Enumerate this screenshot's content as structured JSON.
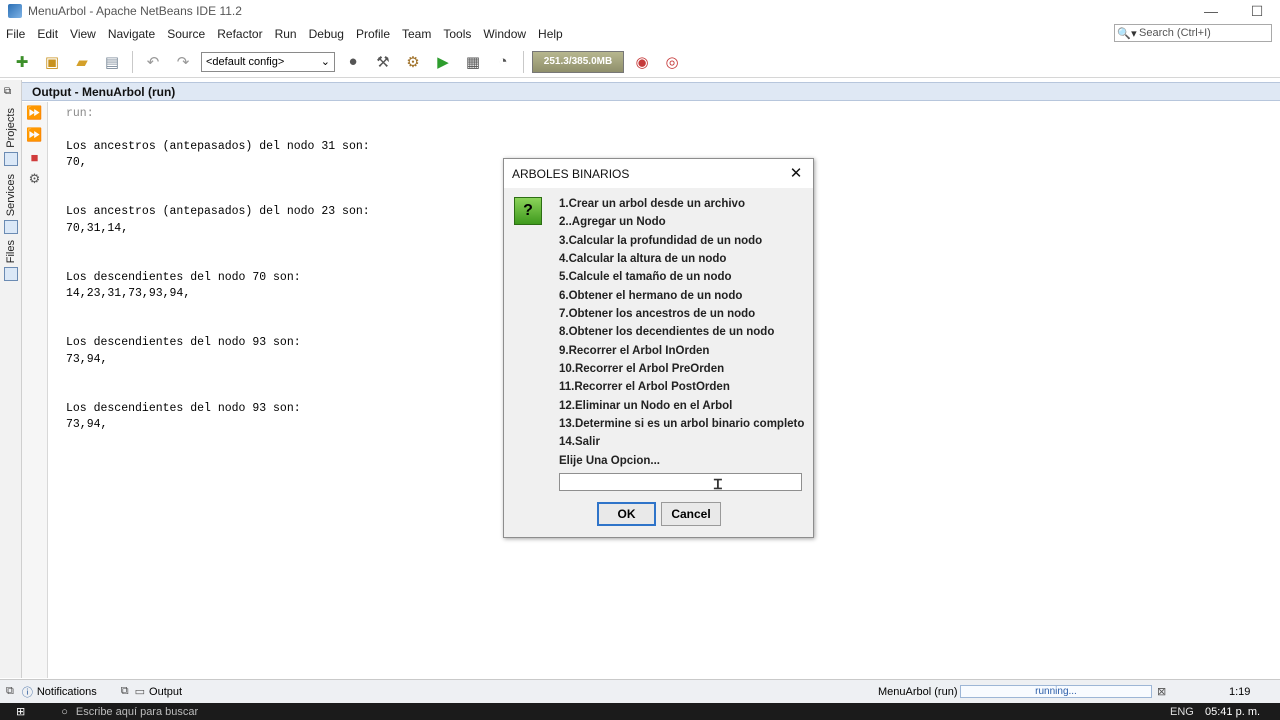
{
  "window": {
    "title": "MenuArbol - Apache NetBeans IDE 11.2",
    "minimize_glyph": "—",
    "maximize_glyph": "☐"
  },
  "menubar": {
    "items": [
      "File",
      "Edit",
      "View",
      "Navigate",
      "Source",
      "Refactor",
      "Run",
      "Debug",
      "Profile",
      "Team",
      "Tools",
      "Window",
      "Help"
    ]
  },
  "search": {
    "placeholder": "Search (Ctrl+I)"
  },
  "toolbar": {
    "config_value": "<default config>",
    "memory": "251.3/385.0MB"
  },
  "side_tabs": {
    "projects": "Projects",
    "services": "Services",
    "files": "Files"
  },
  "output": {
    "header": "Output - MenuArbol (run)",
    "lines": [
      "run:",
      "",
      "Los ancestros (antepasados) del nodo 31 son:",
      "70,",
      "",
      "",
      "Los ancestros (antepasados) del nodo 23 son:",
      "70,31,14,",
      "",
      "",
      "Los descendientes del nodo 70 son:",
      "14,23,31,73,93,94,",
      "",
      "",
      "Los descendientes del nodo 93 son:",
      "73,94,",
      "",
      "",
      "Los descendientes del nodo 93 son:",
      "73,94,"
    ]
  },
  "dialog": {
    "title": "ARBOLES BINARIOS",
    "icon_glyph": "?",
    "options": [
      "1.Crear un arbol desde un archivo",
      "2..Agregar un Nodo",
      "3.Calcular la profundidad de un nodo",
      "4.Calcular la altura de un nodo",
      "5.Calcule el tamaño de un nodo",
      "6.Obtener el hermano de un nodo",
      "7.Obtener los ancestros de un nodo",
      "8.Obtener los decendientes de un nodo",
      "9.Recorrer el Arbol InOrden",
      "10.Recorrer el Arbol PreOrden",
      "11.Recorrer el Arbol PostOrden",
      "12.Eliminar un Nodo en el Arbol",
      "13.Determine si es un arbol binario completo",
      "14.Salir",
      "Elije Una Opcion..."
    ],
    "input_value": "",
    "ok_label": "OK",
    "cancel_label": "Cancel"
  },
  "statusbar": {
    "notifications": "Notifications",
    "output_tab": "Output",
    "project": "MenuArbol (run)",
    "running": "running...",
    "position": "1:19"
  },
  "taskbar": {
    "search_text": "Escribe aquí para buscar",
    "lang": "ENG",
    "time": "05:41 p. m."
  }
}
